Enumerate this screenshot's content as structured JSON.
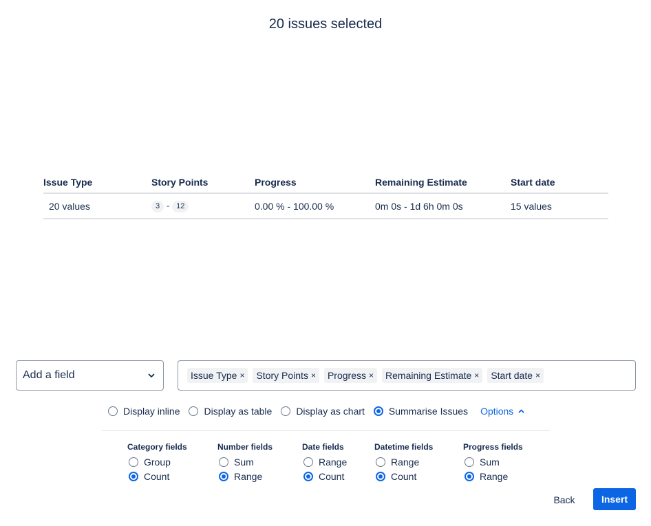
{
  "header": {
    "title": "20 issues selected"
  },
  "table": {
    "columns": [
      "Issue Type",
      "Story Points",
      "Progress",
      "Remaining Estimate",
      "Start date"
    ],
    "row": {
      "issue_type": "20 values",
      "story_points": {
        "min": "3",
        "separator": "-",
        "max": "12"
      },
      "progress": "0.00 % - 100.00 %",
      "remaining_estimate": "0m 0s - 1d 6h 0m 0s",
      "start_date": "15 values"
    }
  },
  "add_field": {
    "label": "Add a field",
    "icon": "chevron-down-icon"
  },
  "selected_fields": [
    {
      "label": "Issue Type",
      "remove": "×"
    },
    {
      "label": "Story Points",
      "remove": "×"
    },
    {
      "label": "Progress",
      "remove": "×"
    },
    {
      "label": "Remaining Estimate",
      "remove": "×"
    },
    {
      "label": "Start date",
      "remove": "×"
    }
  ],
  "display_modes": [
    {
      "label": "Display inline",
      "checked": false
    },
    {
      "label": "Display as table",
      "checked": false
    },
    {
      "label": "Display as chart",
      "checked": false
    },
    {
      "label": "Summarise Issues",
      "checked": true
    }
  ],
  "options_link": {
    "label": "Options",
    "icon": "chevron-up-icon",
    "expanded": true
  },
  "option_groups": [
    {
      "title": "Category fields",
      "options": [
        {
          "label": "Group",
          "checked": false
        },
        {
          "label": "Count",
          "checked": true
        }
      ]
    },
    {
      "title": "Number fields",
      "options": [
        {
          "label": "Sum",
          "checked": false
        },
        {
          "label": "Range",
          "checked": true
        }
      ]
    },
    {
      "title": "Date fields",
      "options": [
        {
          "label": "Range",
          "checked": false
        },
        {
          "label": "Count",
          "checked": true
        }
      ]
    },
    {
      "title": "Datetime fields",
      "options": [
        {
          "label": "Range",
          "checked": false
        },
        {
          "label": "Count",
          "checked": true
        }
      ]
    },
    {
      "title": "Progress fields",
      "options": [
        {
          "label": "Sum",
          "checked": false
        },
        {
          "label": "Range",
          "checked": true
        }
      ]
    }
  ],
  "footer": {
    "back_label": "Back",
    "insert_label": "Insert"
  },
  "colors": {
    "primary": "#0c66e4",
    "text": "#172b4d",
    "border": "#8993a4",
    "divider": "#dfe1e6",
    "tag_bg": "#f1f2f4"
  }
}
